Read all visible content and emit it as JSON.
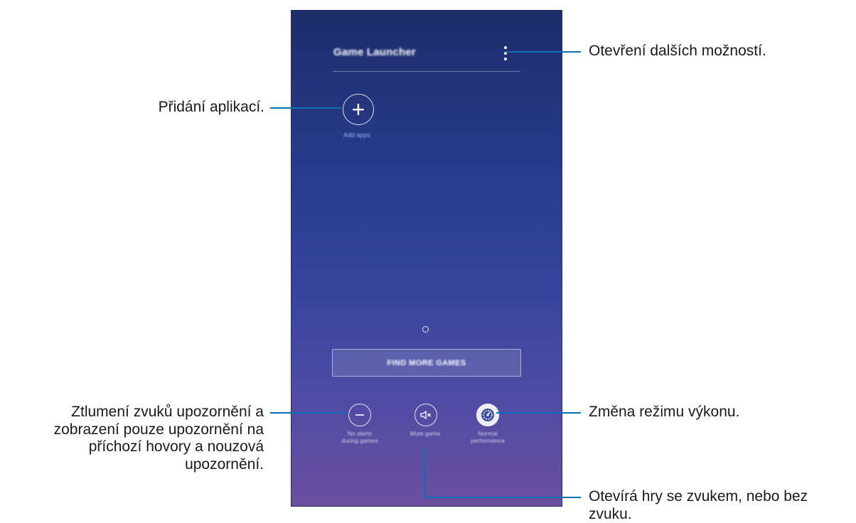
{
  "screen": {
    "app_title": "Game Launcher",
    "add_apps_label": "Add apps",
    "find_more_games_label": "FIND MORE GAMES",
    "no_alerts_label_line1": "No alerts",
    "no_alerts_label_line2": "during games",
    "mute_game_label": "Mute game",
    "performance_label_line1": "Normal",
    "performance_label_line2": "performance",
    "icons": {
      "more_options": "more-options-icon",
      "add_apps": "plus-icon",
      "no_alerts": "minus-circle-icon",
      "mute_game": "speaker-muted-icon",
      "performance": "speedometer-icon"
    }
  },
  "callouts": {
    "more_options": "Otevření dalších možností.",
    "add_apps": "Přidání aplikací.",
    "no_alerts_line1": "Ztlumení zvuků upozornění a",
    "no_alerts_line2": "zobrazení pouze upozornění na",
    "no_alerts_line3": "příchozí hovory a nouzová",
    "no_alerts_line4": "upozornění.",
    "performance": "Změna režimu výkonu.",
    "mute_game_line1": "Otevírá hry se zvukem, nebo bez",
    "mute_game_line2": "zvuku."
  },
  "colors": {
    "callout_line": "#0e6fb5",
    "screen_top": "#1c2d6a",
    "screen_bottom": "#6a4f9f"
  }
}
